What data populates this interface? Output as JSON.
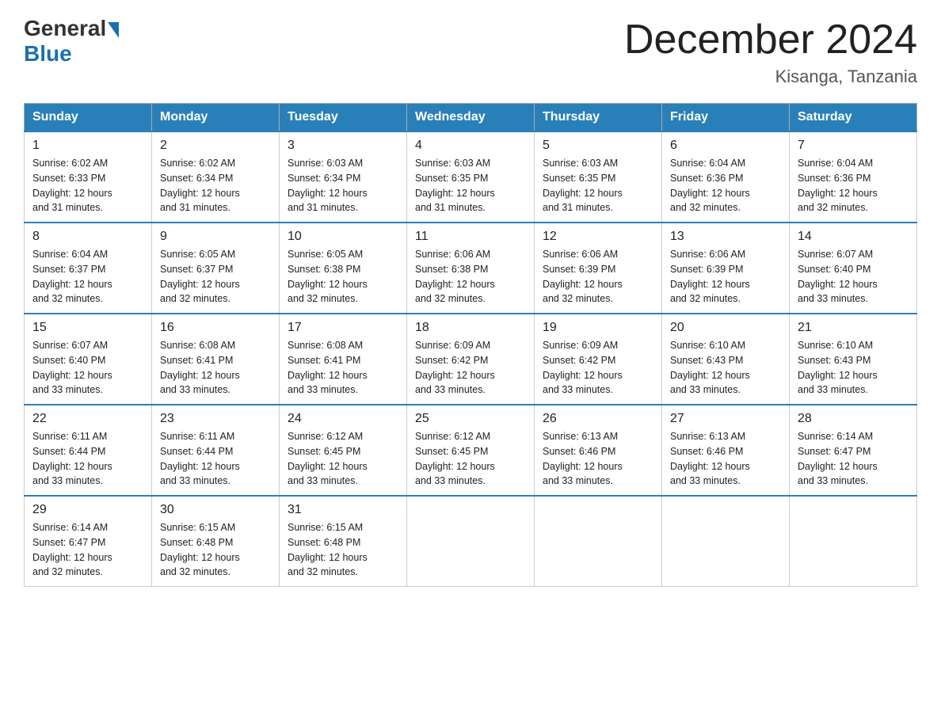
{
  "header": {
    "logo_general": "General",
    "logo_blue": "Blue",
    "month_title": "December 2024",
    "location": "Kisanga, Tanzania"
  },
  "calendar": {
    "days_of_week": [
      "Sunday",
      "Monday",
      "Tuesday",
      "Wednesday",
      "Thursday",
      "Friday",
      "Saturday"
    ],
    "weeks": [
      [
        {
          "day": "1",
          "sunrise": "6:02 AM",
          "sunset": "6:33 PM",
          "daylight": "12 hours and 31 minutes."
        },
        {
          "day": "2",
          "sunrise": "6:02 AM",
          "sunset": "6:34 PM",
          "daylight": "12 hours and 31 minutes."
        },
        {
          "day": "3",
          "sunrise": "6:03 AM",
          "sunset": "6:34 PM",
          "daylight": "12 hours and 31 minutes."
        },
        {
          "day": "4",
          "sunrise": "6:03 AM",
          "sunset": "6:35 PM",
          "daylight": "12 hours and 31 minutes."
        },
        {
          "day": "5",
          "sunrise": "6:03 AM",
          "sunset": "6:35 PM",
          "daylight": "12 hours and 31 minutes."
        },
        {
          "day": "6",
          "sunrise": "6:04 AM",
          "sunset": "6:36 PM",
          "daylight": "12 hours and 32 minutes."
        },
        {
          "day": "7",
          "sunrise": "6:04 AM",
          "sunset": "6:36 PM",
          "daylight": "12 hours and 32 minutes."
        }
      ],
      [
        {
          "day": "8",
          "sunrise": "6:04 AM",
          "sunset": "6:37 PM",
          "daylight": "12 hours and 32 minutes."
        },
        {
          "day": "9",
          "sunrise": "6:05 AM",
          "sunset": "6:37 PM",
          "daylight": "12 hours and 32 minutes."
        },
        {
          "day": "10",
          "sunrise": "6:05 AM",
          "sunset": "6:38 PM",
          "daylight": "12 hours and 32 minutes."
        },
        {
          "day": "11",
          "sunrise": "6:06 AM",
          "sunset": "6:38 PM",
          "daylight": "12 hours and 32 minutes."
        },
        {
          "day": "12",
          "sunrise": "6:06 AM",
          "sunset": "6:39 PM",
          "daylight": "12 hours and 32 minutes."
        },
        {
          "day": "13",
          "sunrise": "6:06 AM",
          "sunset": "6:39 PM",
          "daylight": "12 hours and 32 minutes."
        },
        {
          "day": "14",
          "sunrise": "6:07 AM",
          "sunset": "6:40 PM",
          "daylight": "12 hours and 33 minutes."
        }
      ],
      [
        {
          "day": "15",
          "sunrise": "6:07 AM",
          "sunset": "6:40 PM",
          "daylight": "12 hours and 33 minutes."
        },
        {
          "day": "16",
          "sunrise": "6:08 AM",
          "sunset": "6:41 PM",
          "daylight": "12 hours and 33 minutes."
        },
        {
          "day": "17",
          "sunrise": "6:08 AM",
          "sunset": "6:41 PM",
          "daylight": "12 hours and 33 minutes."
        },
        {
          "day": "18",
          "sunrise": "6:09 AM",
          "sunset": "6:42 PM",
          "daylight": "12 hours and 33 minutes."
        },
        {
          "day": "19",
          "sunrise": "6:09 AM",
          "sunset": "6:42 PM",
          "daylight": "12 hours and 33 minutes."
        },
        {
          "day": "20",
          "sunrise": "6:10 AM",
          "sunset": "6:43 PM",
          "daylight": "12 hours and 33 minutes."
        },
        {
          "day": "21",
          "sunrise": "6:10 AM",
          "sunset": "6:43 PM",
          "daylight": "12 hours and 33 minutes."
        }
      ],
      [
        {
          "day": "22",
          "sunrise": "6:11 AM",
          "sunset": "6:44 PM",
          "daylight": "12 hours and 33 minutes."
        },
        {
          "day": "23",
          "sunrise": "6:11 AM",
          "sunset": "6:44 PM",
          "daylight": "12 hours and 33 minutes."
        },
        {
          "day": "24",
          "sunrise": "6:12 AM",
          "sunset": "6:45 PM",
          "daylight": "12 hours and 33 minutes."
        },
        {
          "day": "25",
          "sunrise": "6:12 AM",
          "sunset": "6:45 PM",
          "daylight": "12 hours and 33 minutes."
        },
        {
          "day": "26",
          "sunrise": "6:13 AM",
          "sunset": "6:46 PM",
          "daylight": "12 hours and 33 minutes."
        },
        {
          "day": "27",
          "sunrise": "6:13 AM",
          "sunset": "6:46 PM",
          "daylight": "12 hours and 33 minutes."
        },
        {
          "day": "28",
          "sunrise": "6:14 AM",
          "sunset": "6:47 PM",
          "daylight": "12 hours and 33 minutes."
        }
      ],
      [
        {
          "day": "29",
          "sunrise": "6:14 AM",
          "sunset": "6:47 PM",
          "daylight": "12 hours and 32 minutes."
        },
        {
          "day": "30",
          "sunrise": "6:15 AM",
          "sunset": "6:48 PM",
          "daylight": "12 hours and 32 minutes."
        },
        {
          "day": "31",
          "sunrise": "6:15 AM",
          "sunset": "6:48 PM",
          "daylight": "12 hours and 32 minutes."
        },
        null,
        null,
        null,
        null
      ]
    ]
  }
}
